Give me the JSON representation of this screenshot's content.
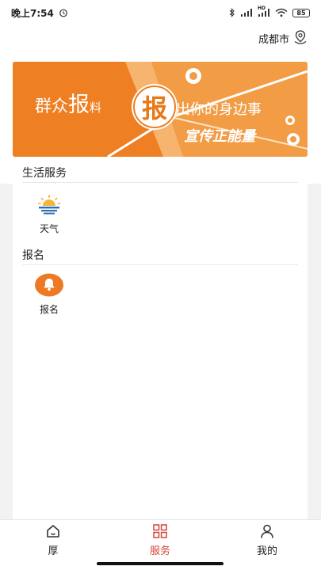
{
  "status_bar": {
    "time": "晚上7:54",
    "signal_text": "HD",
    "battery": "85"
  },
  "location": {
    "city": "成都市",
    "icon": "location-pin-icon"
  },
  "banner": {
    "text_a_1": "群众",
    "text_a_2": "报",
    "text_a_3": "料",
    "center_char": "报",
    "text_b": "出你的身边事",
    "text_c": "宣传正能量",
    "colors": {
      "orange": "#f0963c",
      "dark_orange": "#e87818"
    }
  },
  "sections": [
    {
      "title": "生活服务",
      "items": [
        {
          "label": "天气",
          "icon": "weather-sunrise-icon"
        }
      ]
    },
    {
      "title": "报名",
      "items": [
        {
          "label": "报名",
          "icon": "bell-icon"
        }
      ]
    }
  ],
  "bottom_nav": {
    "items": [
      {
        "label": "厚",
        "icon": "home-icon",
        "active": false
      },
      {
        "label": "服务",
        "icon": "grid-icon",
        "active": true
      },
      {
        "label": "我的",
        "icon": "user-icon",
        "active": false
      }
    ],
    "active_color": "#d2473c"
  }
}
